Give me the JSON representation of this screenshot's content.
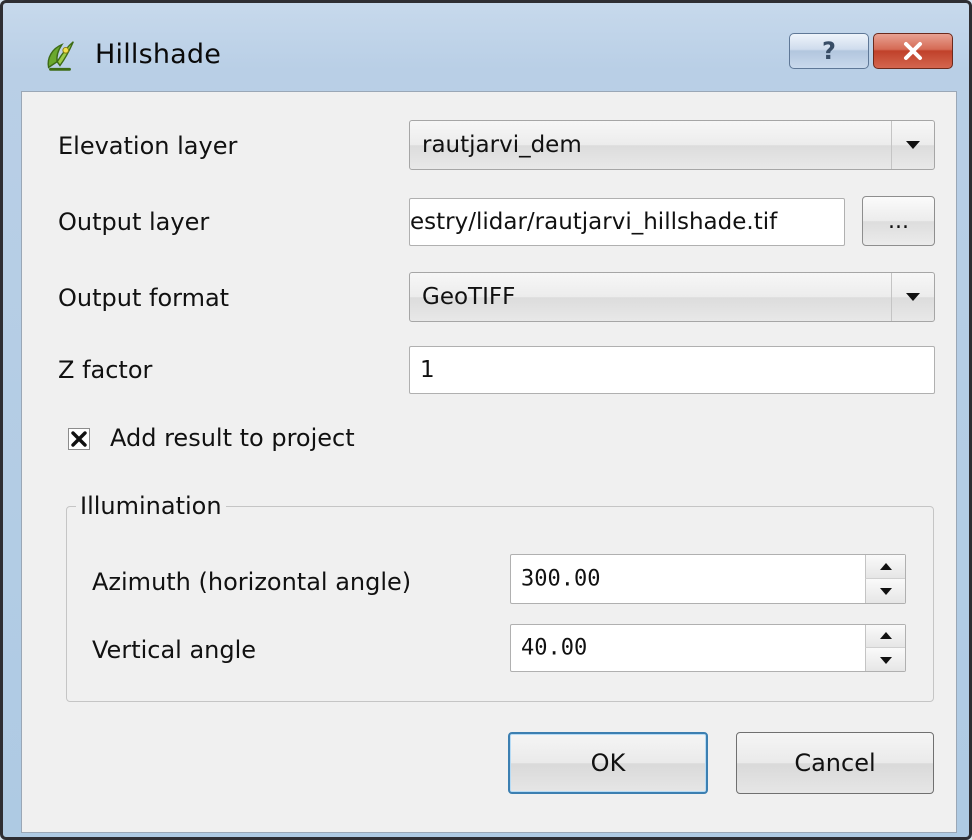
{
  "window": {
    "title": "Hillshade",
    "app_icon": "qgis-logo-icon",
    "help_label": "?",
    "close_icon": "close-icon"
  },
  "form": {
    "elevation_layer": {
      "label": "Elevation layer",
      "value": "rautjarvi_dem"
    },
    "output_layer": {
      "label": "Output layer",
      "value": "estry/lidar/rautjarvi_hillshade.tif",
      "browse_label": "..."
    },
    "output_format": {
      "label": "Output format",
      "value": "GeoTIFF"
    },
    "z_factor": {
      "label": "Z factor",
      "value": "1"
    },
    "add_result": {
      "label": "Add result to project",
      "checked": true
    }
  },
  "illumination": {
    "title": "Illumination",
    "azimuth": {
      "label": "Azimuth (horizontal angle)",
      "value": "300.00"
    },
    "vertical_angle": {
      "label": "Vertical angle",
      "value": "40.00"
    }
  },
  "buttons": {
    "ok": "OK",
    "cancel": "Cancel"
  },
  "colors": {
    "accent_frame": "#aecae3",
    "close_red": "#c0412a",
    "default_button_border": "#3c7fb1"
  }
}
